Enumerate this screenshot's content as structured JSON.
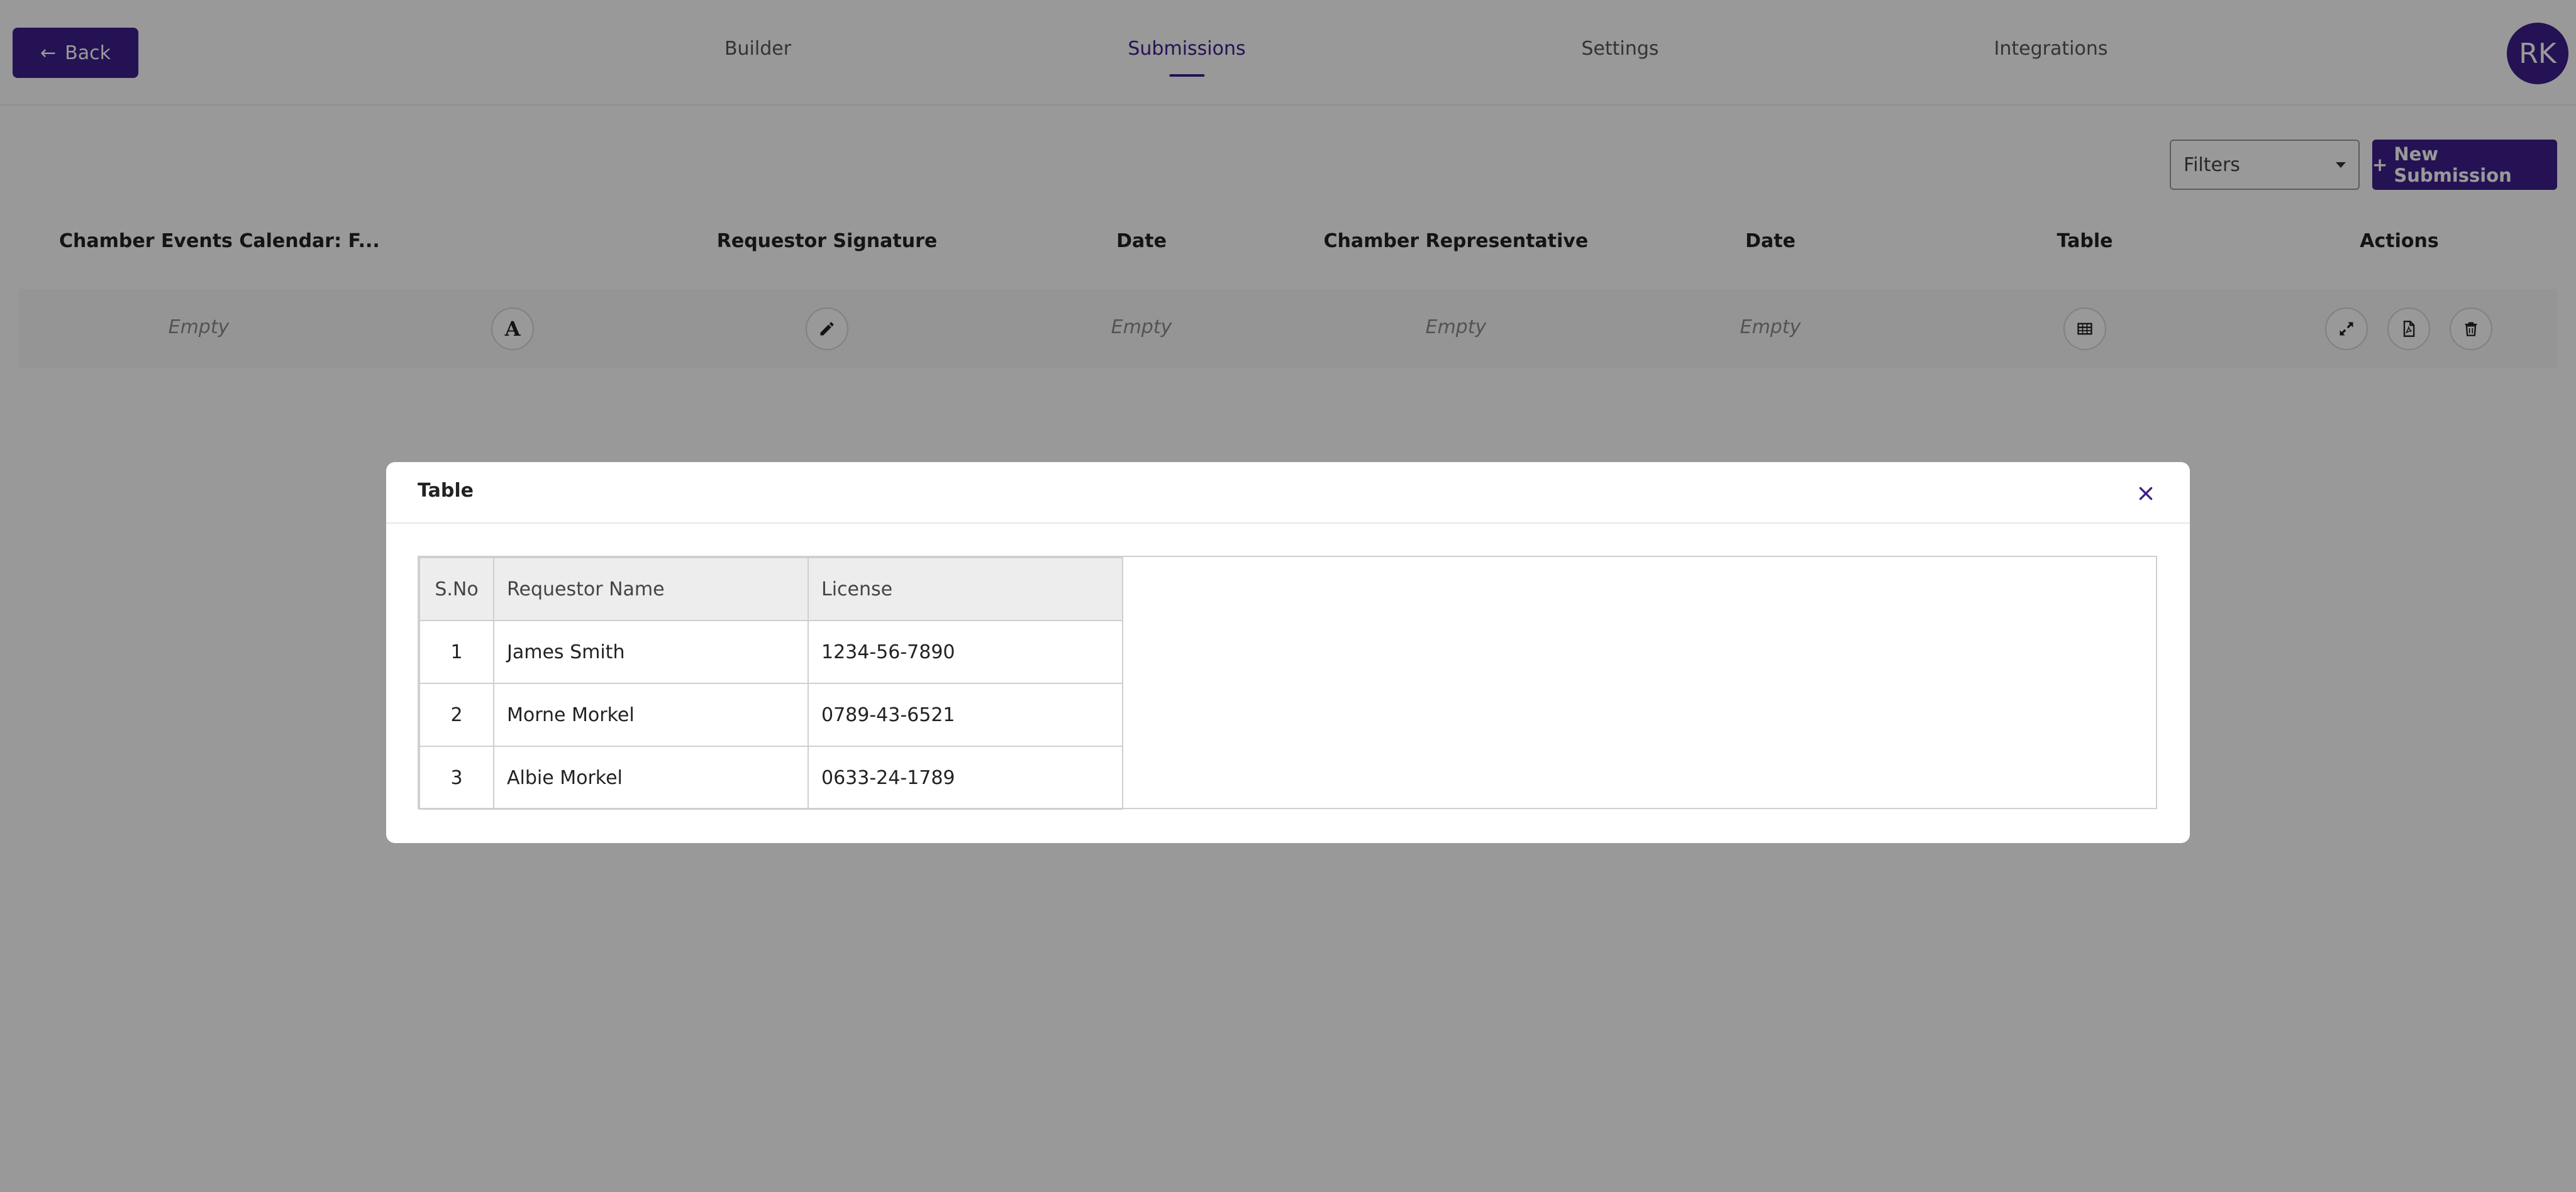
{
  "header": {
    "back_label": "Back",
    "tabs": [
      {
        "label": "Builder",
        "active": false
      },
      {
        "label": "Submissions",
        "active": true
      },
      {
        "label": "Settings",
        "active": false
      },
      {
        "label": "Integrations",
        "active": false
      }
    ],
    "avatar_initials": "RK"
  },
  "toolbar": {
    "filters_value": "Filters",
    "new_submission_label": "New Submission"
  },
  "submissions_table": {
    "columns": [
      "Chamber Events Calendar: F...",
      "Requestor Signature",
      "Date",
      "Chamber Representative",
      "Date",
      "Table",
      "Actions"
    ],
    "row": {
      "event_value": "Empty",
      "date_1": "Empty",
      "chamber_representative": "Empty",
      "date_2": "Empty"
    }
  },
  "modal": {
    "title": "Table",
    "table": {
      "headers": [
        "S.No",
        "Requestor Name",
        "License"
      ],
      "rows": [
        [
          "1",
          "James Smith",
          "1234-56-7890"
        ],
        [
          "2",
          "Morne Morkel",
          "0789-43-6521"
        ],
        [
          "3",
          "Albie Morkel",
          "0633-24-1789"
        ]
      ]
    }
  },
  "colors": {
    "brand": "#3d1e8c",
    "overlay": "rgba(0,0,0,0.40)"
  },
  "icons": {
    "back": "arrow-left-icon",
    "font": "font-a-icon",
    "signature": "pencil-icon",
    "table": "table-grid-icon",
    "expand": "expand-icon",
    "pdf": "pdf-file-icon",
    "delete": "trash-icon",
    "close": "close-icon"
  }
}
